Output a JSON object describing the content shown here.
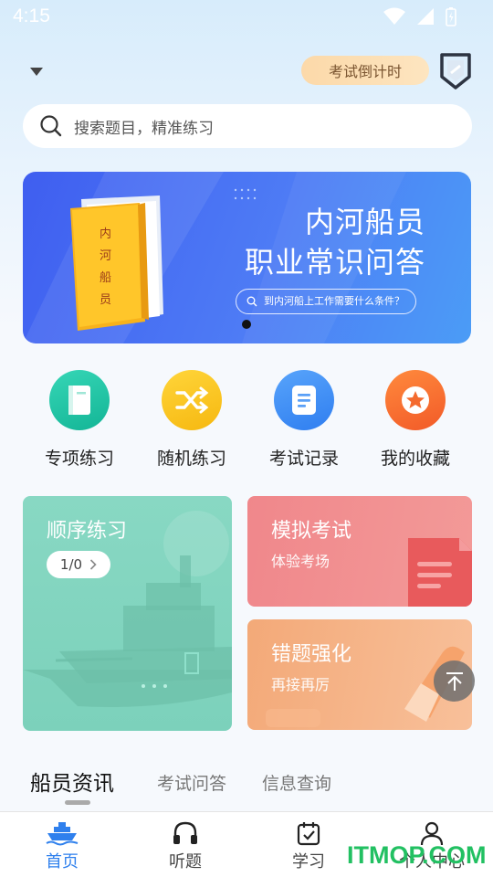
{
  "status_bar": {
    "time": "4:15"
  },
  "header": {
    "countdown_label": "考试倒计时"
  },
  "search": {
    "placeholder": "搜索题目，精准练习"
  },
  "banner": {
    "book_text": "内河船员",
    "title_line1": "内河船员",
    "title_line2": "职业常识问答",
    "question": "到内河船上工作需要什么条件？"
  },
  "quick_actions": [
    {
      "label": "专项练习",
      "icon": "book-icon",
      "color": "#25c4a6"
    },
    {
      "label": "随机练习",
      "icon": "shuffle-icon",
      "color": "#f7c21c"
    },
    {
      "label": "考试记录",
      "icon": "document-icon",
      "color": "#3c8df2"
    },
    {
      "label": "我的收藏",
      "icon": "star-icon",
      "color": "#f5683a"
    }
  ],
  "cards": {
    "sequential": {
      "title": "顺序练习",
      "progress": "1/0"
    },
    "mock_exam": {
      "title": "模拟考试",
      "subtitle": "体验考场"
    },
    "wrong_questions": {
      "title": "错题强化",
      "subtitle": "再接再厉"
    }
  },
  "tabs": [
    "船员资讯",
    "考试问答",
    "信息查询"
  ],
  "bottom_nav": [
    {
      "label": "首页",
      "icon": "ship-icon",
      "active": true
    },
    {
      "label": "听题",
      "icon": "headphones-icon",
      "active": false
    },
    {
      "label": "学习",
      "icon": "calendar-check-icon",
      "active": false
    },
    {
      "label": "个人中心",
      "icon": "user-icon",
      "active": false
    }
  ],
  "watermark": "ITMOP.COM",
  "colors": {
    "accent": "#2f80ed",
    "banner": "#4e7cf5"
  }
}
